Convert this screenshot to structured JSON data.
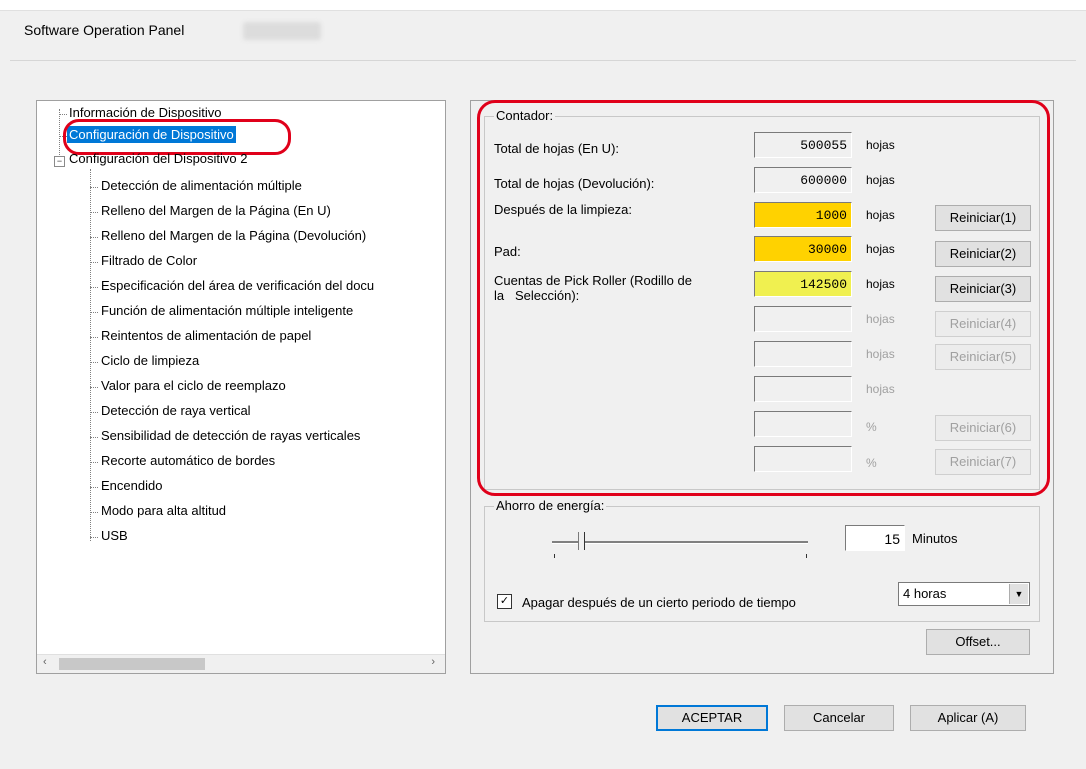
{
  "window": {
    "title": "Software Operation Panel"
  },
  "tree": {
    "items": [
      "Información de Dispositivo",
      "Configuración de Dispositivo",
      "Configuración del Dispositivo 2",
      "Detección de alimentación múltiple",
      "Relleno del Margen de la Página (En U)",
      "Relleno del Margen de la Página (Devolución)",
      "Filtrado de Color",
      "Especificación del área de verificación del docu",
      "Función de alimentación múltiple inteligente",
      "Reintentos de alimentación de papel",
      "Ciclo de limpieza",
      "Valor para el ciclo de reemplazo",
      "Detección de raya vertical",
      "Sensibilidad de detección de rayas verticales",
      "Recorte automático de bordes",
      "Encendido",
      "Modo para alta altitud",
      "USB"
    ],
    "scroll_left": "‹",
    "scroll_right": "›"
  },
  "counter": {
    "group_title": "Contador:",
    "rows": [
      {
        "label": "Total de hojas (En U):",
        "value": "500055",
        "unit": "hojas"
      },
      {
        "label": "Total de hojas (Devolución):",
        "value": "600000",
        "unit": "hojas"
      },
      {
        "label": "Después de la limpieza:",
        "value": "1000",
        "unit": "hojas",
        "button": "Reiniciar(1)"
      },
      {
        "label": "Pad:",
        "value": "30000",
        "unit": "hojas",
        "button": "Reiniciar(2)"
      },
      {
        "label": "Cuentas de Pick Roller (Rodillo de\nla   Selección):",
        "value": "142500",
        "unit": "hojas",
        "button": "Reiniciar(3)"
      },
      {
        "label": "",
        "value": "",
        "unit": "hojas",
        "button": "Reiniciar(4)"
      },
      {
        "label": "",
        "value": "",
        "unit": "hojas",
        "button": "Reiniciar(5)"
      },
      {
        "label": "",
        "value": "",
        "unit": "hojas"
      },
      {
        "label": "",
        "value": "",
        "unit": "%",
        "button": "Reiniciar(6)"
      },
      {
        "label": "",
        "value": "",
        "unit": "%",
        "button": "Reiniciar(7)"
      }
    ],
    "colors": {
      "orange": "#ffd200",
      "yellow": "#f0f050"
    }
  },
  "energy": {
    "group_title": "Ahorro de energía:",
    "minutes_value": "15",
    "minutes_label": "Minutos",
    "poweroff_label": "Apagar después de un cierto periodo de tiempo",
    "poweroff_checked": true,
    "hours_value": "4 horas"
  },
  "buttons": {
    "offset": "Offset...",
    "ok": "ACEPTAR",
    "cancel": "Cancelar",
    "apply": "Aplicar (A)"
  },
  "highlight_color": "#e0001a"
}
